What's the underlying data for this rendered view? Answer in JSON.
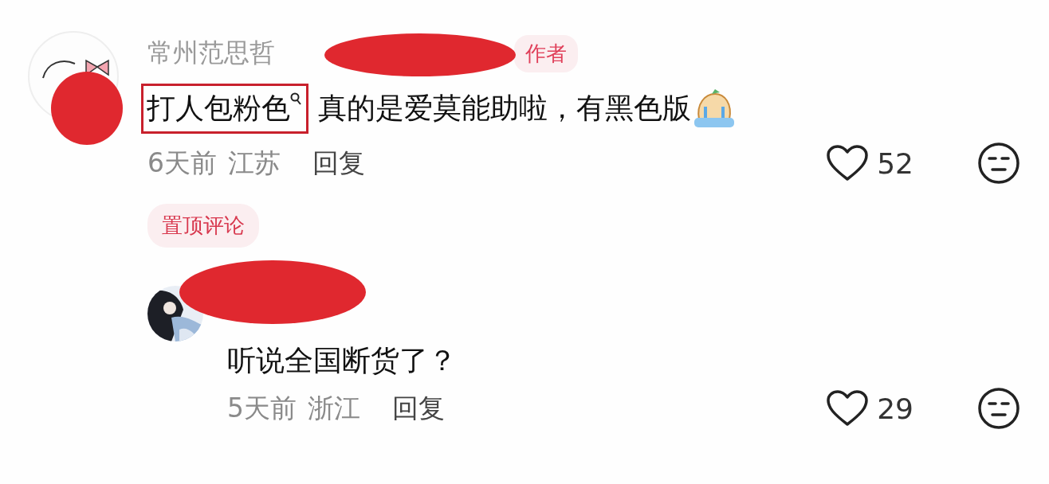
{
  "comments": [
    {
      "author": "常州范思哲",
      "author_badge": "作者",
      "highlight": "打人包粉色",
      "text": "真的是爱莫能助啦，有黑色版",
      "time": "6天前",
      "location": "江苏",
      "reply": "回复",
      "likes": "52",
      "pinned_label": "置顶评论",
      "replies": [
        {
          "text": "听说全国断货了？",
          "time": "5天前",
          "location": "浙江",
          "reply": "回复",
          "likes": "29"
        }
      ]
    }
  ]
}
